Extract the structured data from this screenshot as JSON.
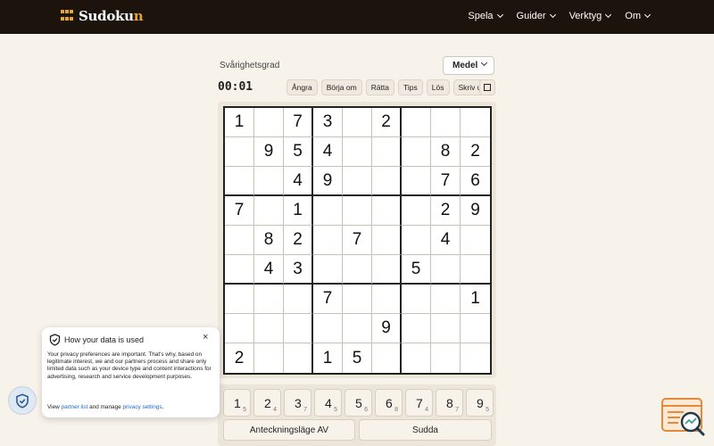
{
  "brand": {
    "name_main": "Sudoku",
    "name_accent": "n"
  },
  "nav": [
    {
      "label": "Spela"
    },
    {
      "label": "Guider"
    },
    {
      "label": "Verktyg"
    },
    {
      "label": "Om"
    }
  ],
  "difficulty": {
    "label": "Svårighetsgrad",
    "selected": "Medel"
  },
  "timer": "00:01",
  "toolbar": [
    "Ångra",
    "Börja om",
    "Rätta",
    "Tips",
    "Lös",
    "Skriv ut"
  ],
  "board": [
    [
      "1",
      "",
      "7",
      "3",
      "",
      "2",
      "",
      "",
      ""
    ],
    [
      "",
      "9",
      "5",
      "4",
      "",
      "",
      "",
      "8",
      "2"
    ],
    [
      "",
      "",
      "4",
      "9",
      "",
      "",
      "",
      "7",
      "6"
    ],
    [
      "7",
      "",
      "1",
      "",
      "",
      "",
      "",
      "2",
      "9"
    ],
    [
      "",
      "8",
      "2",
      "",
      "7",
      "",
      "",
      "4",
      ""
    ],
    [
      "",
      "4",
      "3",
      "",
      "",
      "",
      "5",
      "",
      ""
    ],
    [
      "",
      "",
      "",
      "7",
      "",
      "",
      "",
      "",
      "1"
    ],
    [
      "",
      "",
      "",
      "",
      "",
      "9",
      "",
      "",
      ""
    ],
    [
      "2",
      "",
      "",
      "1",
      "5",
      "",
      "",
      "",
      ""
    ]
  ],
  "pad": [
    {
      "num": "1",
      "count": "5"
    },
    {
      "num": "2",
      "count": "4"
    },
    {
      "num": "3",
      "count": "7"
    },
    {
      "num": "4",
      "count": "5"
    },
    {
      "num": "5",
      "count": "6"
    },
    {
      "num": "6",
      "count": "8"
    },
    {
      "num": "7",
      "count": "4"
    },
    {
      "num": "8",
      "count": "7"
    },
    {
      "num": "9",
      "count": "5"
    }
  ],
  "actions": {
    "notes": "Anteckningsläge AV",
    "erase": "Sudda"
  },
  "privacy": {
    "title": "How your data is used",
    "close": "×",
    "text": "Your privacy preferences are important. That's why, based on legitimate interest, we and our partners process and share only limited data such as your device type and content interactions for advertising, research and service development purposes.",
    "view": "View",
    "partner_link": "partner list",
    "and_manage": "and manage",
    "settings_link": "privacy settings",
    "period": "."
  },
  "colors": {
    "header_bg": "#1b130c",
    "accent": "#e4a62c",
    "page_bg": "#f8f3ea",
    "link": "#1f66c9"
  },
  "icons": {
    "consent": "shield-check-icon",
    "corner": "search-analytics-icon"
  }
}
